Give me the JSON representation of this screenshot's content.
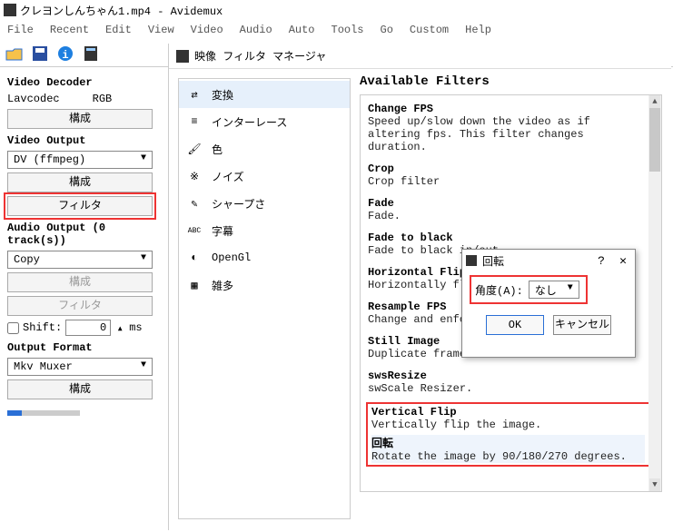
{
  "window": {
    "title": "クレヨンしんちゃん1.mp4 - Avidemux"
  },
  "menu": [
    "File",
    "Recent",
    "Edit",
    "View",
    "Video",
    "Audio",
    "Auto",
    "Tools",
    "Go",
    "Custom",
    "Help"
  ],
  "left": {
    "decoder_h": "Video Decoder",
    "decoder_name": "Lavcodec",
    "decoder_mode": "RGB",
    "configure": "構成",
    "video_out_h": "Video Output",
    "video_out_sel": "DV (ffmpeg)",
    "filter": "フィルタ",
    "audio_out_h": "Audio Output (0 track(s))",
    "audio_out_sel": "Copy",
    "shift_label": "Shift:",
    "shift_val": "0",
    "shift_unit": "ms",
    "outfmt_h": "Output Format",
    "outfmt_sel": "Mkv Muxer"
  },
  "fm": {
    "title": "映像 フィルタ マネージャ",
    "avail_h": "Available Filters",
    "cats": [
      "変換",
      "インターレース",
      "色",
      "ノイズ",
      "シャープさ",
      "字幕",
      "OpenGl",
      "雑多"
    ],
    "filters": [
      {
        "n": "Change FPS",
        "d": "Speed up/slow down the video as if altering fps. This filter changes duration."
      },
      {
        "n": "Crop",
        "d": "Crop filter"
      },
      {
        "n": "Fade",
        "d": "Fade."
      },
      {
        "n": "Fade to black",
        "d": "Fade to black in/out."
      },
      {
        "n": "Horizontal Flip",
        "d": "Horizontally flip"
      },
      {
        "n": "Resample FPS",
        "d": "Change and enforce"
      },
      {
        "n": "Still Image",
        "d": "Duplicate frames f"
      },
      {
        "n": "swsResize",
        "d": "swScale Resizer."
      },
      {
        "n": "Vertical Flip",
        "d": "Vertically flip the image."
      },
      {
        "n": "回転",
        "d": "Rotate the image by 90/180/270 degrees."
      }
    ]
  },
  "dlg": {
    "title": "回転",
    "angle_label": "角度(A):",
    "angle_sel": "なし",
    "ok": "OK",
    "cancel": "キャンセル"
  }
}
